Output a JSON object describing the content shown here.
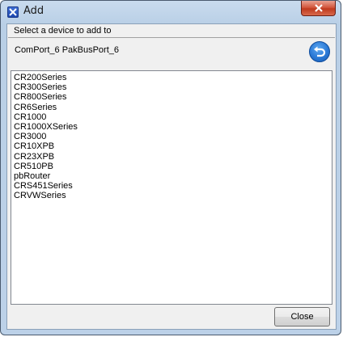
{
  "window": {
    "title": "Add"
  },
  "header": {
    "label": "Select a device to add to"
  },
  "target": {
    "text": "ComPort_6   PakBusPort_6"
  },
  "devices": [
    "CR200Series",
    "CR300Series",
    "CR800Series",
    "CR6Series",
    "CR1000",
    "CR1000XSeries",
    "CR3000",
    "CR10XPB",
    "CR23XPB",
    "CR510PB",
    "pbRouter",
    "CRS451Series",
    "CRVWSeries"
  ],
  "footer": {
    "close_label": "Close"
  },
  "icons": {
    "app": "app-icon",
    "back": "back-arrow-icon",
    "close": "close-icon"
  },
  "colors": {
    "close_button": "#c7472b",
    "back_button": "#2a79d6"
  }
}
